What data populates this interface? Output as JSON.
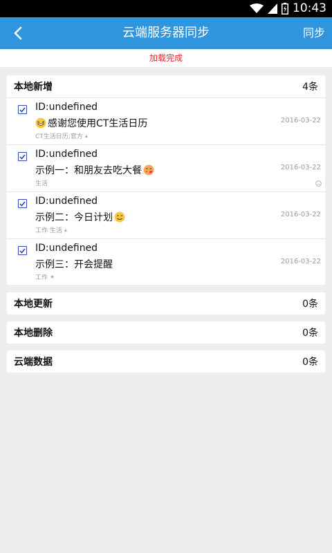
{
  "status_bar": {
    "time": "10:43"
  },
  "app_bar": {
    "title": "云端服务器同步",
    "sync_label": "同步",
    "back_icon": "chevron-left-icon"
  },
  "status_message": "加载完成",
  "colors": {
    "app_bar": "#2f96de",
    "status_message": "#e22222",
    "checkbox": "#3548b8"
  },
  "sections": {
    "local_new": {
      "title": "本地新增",
      "count": "4条",
      "items": [
        {
          "id": "ID:undefined",
          "title": "感谢您使用CT生活日历",
          "tags": "CT生活日历;官方",
          "date": "2016-03-22",
          "checked": true,
          "title_emoji": "laughing-face-icon",
          "tag_icon": "triangle-icon"
        },
        {
          "id": "ID:undefined",
          "title": "示例一：和朋友去吃大餐",
          "tags": "生活",
          "date": "2016-03-22",
          "checked": true,
          "title_emoji": "kissing-face-icon",
          "right_icon": "smile-icon"
        },
        {
          "id": "ID:undefined",
          "title": "示例二：今日计划",
          "tags": "工作 生活",
          "date": "2016-03-22",
          "checked": true,
          "title_emoji": "wink-face-icon",
          "tag_icon": "triangle-icon"
        },
        {
          "id": "ID:undefined",
          "title": "示例三：开会提醒",
          "tags": "工作",
          "date": "2016-03-22",
          "checked": true,
          "tag_icon": "star-icon"
        }
      ]
    },
    "local_update": {
      "title": "本地更新",
      "count": "0条"
    },
    "local_delete": {
      "title": "本地删除",
      "count": "0条"
    },
    "cloud_data": {
      "title": "云端数据",
      "count": "0条"
    }
  }
}
